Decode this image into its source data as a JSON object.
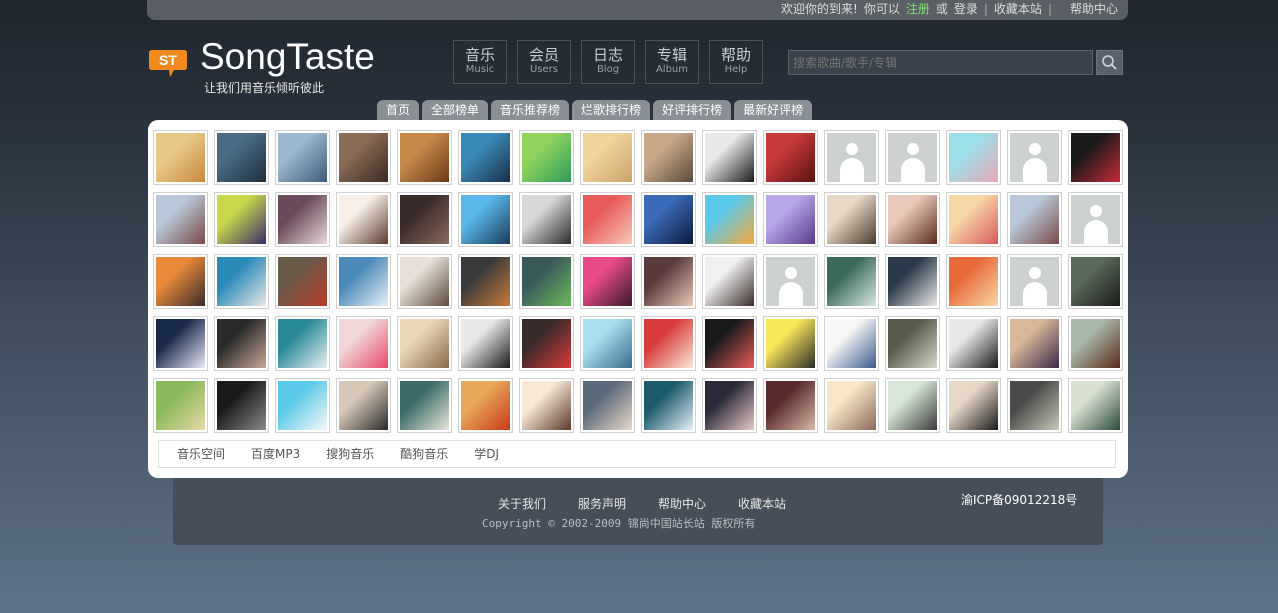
{
  "topbar": {
    "welcome": "欢迎你的到来!",
    "you_can": "你可以",
    "register": "注册",
    "or": "或",
    "login": "登录",
    "sep": "|",
    "bookmark": "收藏本站",
    "help": "帮助中心"
  },
  "brand": {
    "logo_text": "ST",
    "name": "SongTaste",
    "slogan": "让我们用音乐倾听彼此"
  },
  "nav": [
    {
      "cn": "音乐",
      "en": "Music"
    },
    {
      "cn": "会员",
      "en": "Users"
    },
    {
      "cn": "日志",
      "en": "Blog"
    },
    {
      "cn": "专辑",
      "en": "Album"
    },
    {
      "cn": "帮助",
      "en": "Help"
    }
  ],
  "search": {
    "placeholder": "搜索歌曲/歌手/专辑",
    "icon": "search-icon"
  },
  "tabs": [
    "首页",
    "全部榜单",
    "音乐推荐榜",
    "烂歌排行榜",
    "好评排行榜",
    "最新好评榜"
  ],
  "avatars": [
    [
      "#e9c98a",
      "#c78a3d"
    ],
    [
      "#4a6b84",
      "#1e2f3c"
    ],
    [
      "#9bb8cf",
      "#3d5c78"
    ],
    [
      "#8a6b56",
      "#3b2a22"
    ],
    [
      "#c88a4a",
      "#6a3b1a"
    ],
    [
      "#3a8ab8",
      "#1a2f4a"
    ],
    [
      "#8fd35c",
      "#2f9b5a"
    ],
    [
      "#f0d49a",
      "#c9a46a"
    ],
    [
      "#c9a88a",
      "#5a4a3a"
    ],
    [
      "#e8e8e8",
      "#1a1a1a"
    ],
    [
      "#c83a3a",
      "#5a1010"
    ],
    "placeholder",
    "placeholder",
    [
      "#9be0e8",
      "#e8a8b8"
    ],
    "placeholder",
    [
      "#1a1a1a",
      "#c82a3a"
    ],
    [
      "#b8c8d8",
      "#7a4a4a"
    ],
    [
      "#c8d84a",
      "#3a2a6a"
    ],
    [
      "#6a4a5a",
      "#e8d8d8"
    ],
    [
      "#f8f0e8",
      "#5a3a2a"
    ],
    [
      "#3a2a2a",
      "#8a6a5a"
    ],
    [
      "#5ab8e8",
      "#1a3a5a"
    ],
    [
      "#d8d8d8",
      "#2a2a2a"
    ],
    [
      "#e85a5a",
      "#f8c8b8"
    ],
    [
      "#3a6ab8",
      "#0a1a3a"
    ],
    [
      "#5ac8e8",
      "#f8a83a"
    ],
    [
      "#b8a8e8",
      "#5a3a8a"
    ],
    [
      "#e8d8c8",
      "#4a3a2a"
    ],
    [
      "#e8c8b8",
      "#5a2a1a"
    ],
    [
      "#f8d8a8",
      "#d85a5a"
    ],
    [
      "#b8c8d8",
      "#7a4a4a"
    ],
    "placeholder",
    [
      "#e88a3a",
      "#3a2a2a"
    ],
    [
      "#2a8ab8",
      "#e8e8e8"
    ],
    [
      "#6a5a4a",
      "#b83a2a"
    ],
    [
      "#4a8ab8",
      "#e8f0f8"
    ],
    [
      "#e8e0d8",
      "#5a4a3a"
    ],
    [
      "#3a3a3a",
      "#c87a3a"
    ],
    [
      "#3a5a5a",
      "#6ab85a"
    ],
    [
      "#e84a8a",
      "#3a1a2a"
    ],
    [
      "#5a3a3a",
      "#e8c8b8"
    ],
    [
      "#f0f0f0",
      "#3a2a2a"
    ],
    "placeholder",
    [
      "#3a6a5a",
      "#d8e8e0"
    ],
    [
      "#2a3a4a",
      "#e8e8e8"
    ],
    [
      "#e86a3a",
      "#f8d8a8"
    ],
    "placeholder",
    [
      "#5a6a5a",
      "#1a1a1a"
    ],
    [
      "#1a2a4a",
      "#e8e8f8"
    ],
    [
      "#2a2a2a",
      "#c8a898"
    ],
    [
      "#2a8a9a",
      "#e8f0f0"
    ],
    [
      "#f0d8d8",
      "#e84a6a"
    ],
    [
      "#e8d8b8",
      "#8a6a4a"
    ],
    [
      "#e8e8e8",
      "#1a1a1a"
    ],
    [
      "#3a2a2a",
      "#d83a3a"
    ],
    [
      "#a8e0f0",
      "#3a6a8a"
    ],
    [
      "#d83a3a",
      "#f8e8d8"
    ],
    [
      "#1a1a1a",
      "#e85a5a"
    ],
    [
      "#f8e85a",
      "#2a2a2a"
    ],
    [
      "#f8f8f8",
      "#3a5a8a"
    ],
    [
      "#5a5a4a",
      "#d8d8c8"
    ],
    [
      "#e8e8e8",
      "#1a1a1a"
    ],
    [
      "#d8b898",
      "#3a2a4a"
    ],
    [
      "#a8b8a8",
      "#5a2a1a"
    ],
    [
      "#8ab85a",
      "#e8d8a8"
    ],
    [
      "#1a1a1a",
      "#8a8a8a"
    ],
    [
      "#5ac8e8",
      "#f8f8f8"
    ],
    [
      "#d8c8b8",
      "#2a2a2a"
    ],
    [
      "#3a6a6a",
      "#e8e8d8"
    ],
    [
      "#e8a85a",
      "#c83a1a"
    ],
    [
      "#f8e8d8",
      "#5a3a2a"
    ],
    [
      "#5a6a7a",
      "#e8d8c8"
    ],
    [
      "#1a5a6a",
      "#e8f0f8"
    ],
    [
      "#2a2a3a",
      "#e8c8c8"
    ],
    [
      "#5a2a2a",
      "#d8b8a8"
    ],
    [
      "#f8e8c8",
      "#8a6a5a"
    ],
    [
      "#d8e8d8",
      "#3a3a3a"
    ],
    [
      "#e8d8c8",
      "#1a1a1a"
    ],
    [
      "#4a4a4a",
      "#c8c8b8"
    ],
    [
      "#d8e0d0",
      "#2a4a3a"
    ]
  ],
  "links": [
    "音乐空间",
    "百度MP3",
    "搜狗音乐",
    "酷狗音乐",
    "学DJ"
  ],
  "footer": {
    "nav": [
      "关于我们",
      "服务声明",
      "帮助中心",
      "收藏本站"
    ],
    "icp": "渝ICP备09012218号",
    "copyright": "Copyright © 2002-2009 锦尚中国站长站 版权所有"
  }
}
